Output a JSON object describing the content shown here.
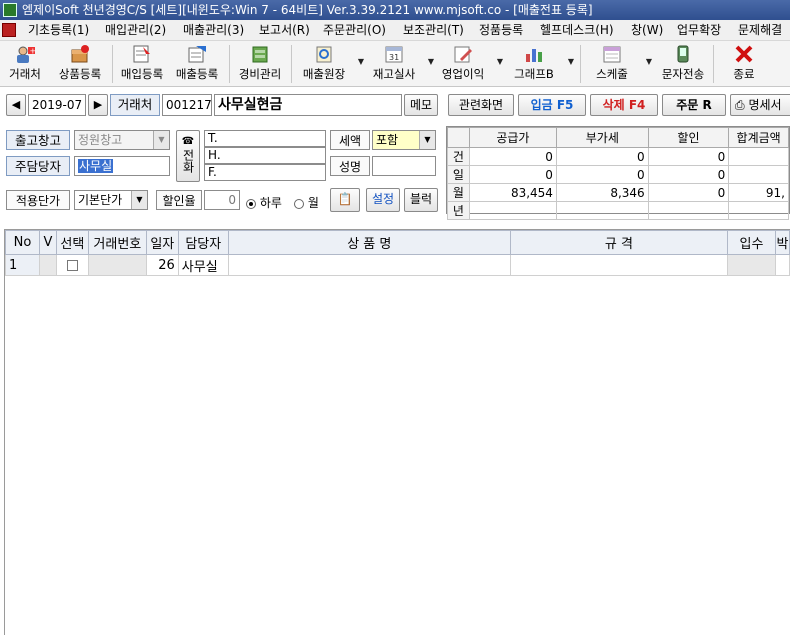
{
  "title": "엠제이Soft 천년경영C/S [세트][내윈도우:Win 7 - 64비트] Ver.3.39.2121          www.mjsoft.co - [매출전표 등록]",
  "menu": [
    "기초등록(1)",
    "매입관리(2)",
    "매출관리(3)",
    "보고서(R)",
    "주문관리(O)",
    "보조관리(T)",
    "정품등록",
    "헬프데스크(H)",
    "창(W)",
    "업무확장",
    "문제해결"
  ],
  "toolbar": {
    "customer": "거래처",
    "product": "상품등록",
    "purchase": "매입등록",
    "sales": "매출등록",
    "expense": "경비관리",
    "sales_ledger": "매출원장",
    "inventory": "재고실사",
    "profit": "영업이익",
    "graph": "그래프B",
    "schedule": "스케줄",
    "sms": "문자전송",
    "exit": "종료",
    "inventory_day": "31"
  },
  "nav": {
    "prev": "◀",
    "date": "2019-07",
    "next": "▶",
    "customer_label": "거래처",
    "customer_code": "001217",
    "customer_name": "사무실현금",
    "memo": "메모"
  },
  "actions": {
    "related": "관련화면",
    "deposit": "입금 F5",
    "delete": "삭제 F4",
    "order": "주문 R",
    "statement": "명세서"
  },
  "form": {
    "warehouse_label": "출고창고",
    "warehouse_value": "정원창고",
    "manager_label": "주담당자",
    "manager_value": "사무실",
    "phone_label": "전화",
    "phone_t": "T.",
    "phone_h": "H.",
    "phone_f": "F.",
    "tax_label": "세액",
    "tax_value": "포함",
    "name_label": "성명",
    "price_label": "적용단가",
    "price_value": "기본단가",
    "discount_label": "할인율",
    "discount_value": "0",
    "radio_day": "하루",
    "radio_month": "월",
    "settings": "설정",
    "block": "블럭"
  },
  "summary": {
    "headers": [
      "공급가",
      "부가세",
      "할인",
      "합계금액"
    ],
    "rows": [
      {
        "label": "건",
        "values": [
          "0",
          "0",
          "0",
          ""
        ]
      },
      {
        "label": "일",
        "values": [
          "0",
          "0",
          "0",
          ""
        ]
      },
      {
        "label": "월",
        "values": [
          "83,454",
          "8,346",
          "0",
          "91,"
        ]
      },
      {
        "label": "년",
        "values": [
          "",
          "",
          "",
          ""
        ]
      }
    ]
  },
  "grid": {
    "headers": [
      "No",
      "V",
      "선택",
      "거래번호",
      "일자",
      "담당자",
      "상 품 명",
      "규 격",
      "입수",
      "박"
    ],
    "rows": [
      {
        "no": "1",
        "v": "",
        "trade_no": "",
        "day": "26",
        "manager": "사무실",
        "product": "",
        "spec": "",
        "qty": ""
      }
    ]
  }
}
